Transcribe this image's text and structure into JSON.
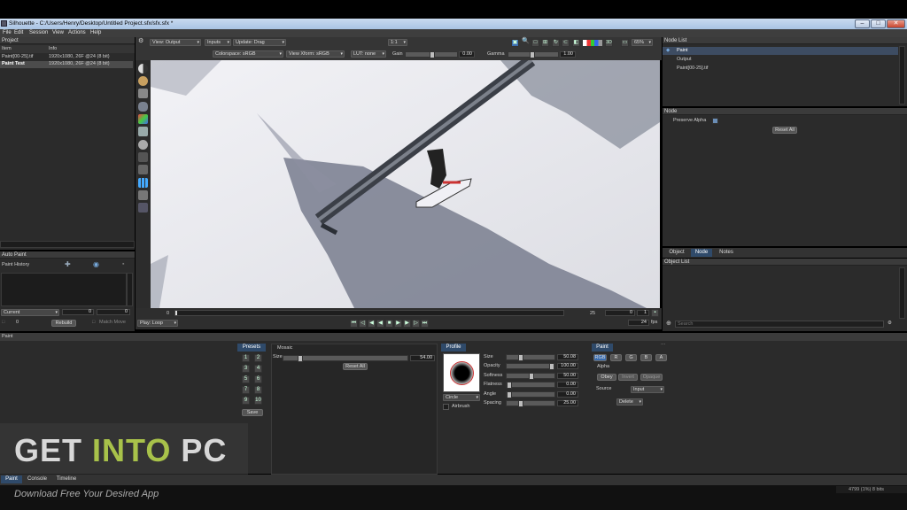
{
  "window": {
    "title": "Silhouette - C:/Users/Henry/Desktop/Untitled Project.sfx/sfx.sfx *",
    "minimize": "–",
    "maximize": "□",
    "close": "✕"
  },
  "menu": [
    "File",
    "Edit",
    "Session",
    "View",
    "Actions",
    "Help"
  ],
  "project": {
    "title": "Project",
    "col_item": "Item",
    "col_info": "Info",
    "rows": [
      {
        "item": "Paint[00-25].tif",
        "info": "1920x1080, 26F @24 (8 bit)"
      },
      {
        "item": "Paint Test",
        "info": "1920x1080, 26F @24 (8 bit)"
      }
    ]
  },
  "viewer_toolbar": {
    "view": "View: Output",
    "inputs": "Inputs",
    "update": "Update: Drag",
    "ratio": "1:1",
    "zoom": "65%",
    "colorspace": "Colorspace: sRGB",
    "view_xform": "View Xform: sRGB",
    "lut": "LUT: none",
    "gain_label": "Gain",
    "gain_value": "0.00",
    "gamma_label": "Gamma",
    "gamma_value": "1.00",
    "mono_label": "3D"
  },
  "timeline": {
    "start": "0",
    "end": "25",
    "current": "0",
    "step": "1",
    "fps": "24",
    "fps_unit": "fps",
    "play_mode": "Play: Loop"
  },
  "autopaint": {
    "title": "Auto Paint",
    "history_label": "Paint History",
    "current": "Current",
    "val_a": "0",
    "val_b": "0",
    "frame": "0",
    "rebuild": "Rebuild",
    "match_move": "Match Move"
  },
  "node_list": {
    "title": "Node List",
    "items": [
      "Paint",
      "Output",
      "Paint[00-25].tif"
    ]
  },
  "node": {
    "title": "Node",
    "preserve_alpha": "Preserve Alpha",
    "reset_all": "Reset All"
  },
  "right_tabs": [
    "Object",
    "Node",
    "Notes"
  ],
  "object_list": {
    "title": "Object List",
    "search_placeholder": "Search"
  },
  "paint": {
    "title": "Paint",
    "presets_title": "Presets",
    "preset_buttons": [
      "1",
      "2",
      "3",
      "4",
      "5",
      "6",
      "7",
      "8",
      "9",
      "10"
    ],
    "save": "Save",
    "mosaic_title": "Mosaic",
    "size_label": "Size",
    "size_value": "54.00",
    "mosaic_reset": "Reset All",
    "profile_title": "Profile",
    "profile_shape": "Circle",
    "airbrush": "Airbrush",
    "params": [
      {
        "label": "Size",
        "value": "50.08",
        "pct": 0.25
      },
      {
        "label": "Opacity",
        "value": "100.00",
        "pct": 1.0
      },
      {
        "label": "Softness",
        "value": "50.00",
        "pct": 0.5
      },
      {
        "label": "Flatness",
        "value": "0.00",
        "pct": 0.0
      },
      {
        "label": "Angle",
        "value": "0.00",
        "pct": 0.0
      },
      {
        "label": "Spacing",
        "value": "25.00",
        "pct": 0.25
      }
    ],
    "right_title": "Paint",
    "channels": [
      "RGB",
      "R",
      "G",
      "B",
      "A"
    ],
    "alpha_label": "Alpha",
    "alpha_buttons": [
      "Obey",
      "Invert",
      "Opaque"
    ],
    "source_label": "Source",
    "source_value": "Input",
    "delete": "Delete"
  },
  "bottom_tabs": [
    "Paint",
    "Console",
    "Timeline"
  ],
  "watermark": {
    "line1a": "GET ",
    "line1b": "INTO",
    "line1c": " PC",
    "line2": "Download Free Your Desired App"
  },
  "status": "4799 (1%) 8 bits",
  "colors": {
    "accent": "#2f4a6a",
    "panel": "#2b2b2b",
    "watermark_green": "#a8c24a"
  }
}
